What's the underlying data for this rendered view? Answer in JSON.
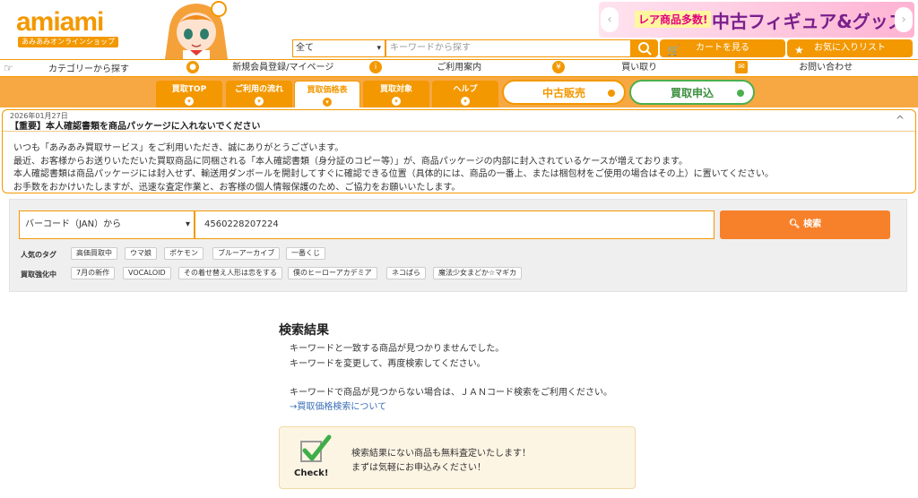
{
  "header": {
    "logo_text": "amiami",
    "logo_sub": "あみあみオンラインショップ",
    "banner_tag": "レア商品多数!",
    "banner_main": "中古フィギュア&グッズ",
    "category_select": "全て",
    "keyword_placeholder": "キーワードから探す",
    "cart_label": "カートを見る",
    "favorites_label": "お気に入りリスト"
  },
  "nav": {
    "category": "カテゴリーから探す",
    "register": "新規会員登録/マイページ",
    "guide": "ご利用案内",
    "buyback": "買い取り",
    "contact": "お問い合わせ"
  },
  "tabs": [
    {
      "label": "買取TOP"
    },
    {
      "label": "ご利用の流れ"
    },
    {
      "label": "買取価格表"
    },
    {
      "label": "買取対象"
    },
    {
      "label": "ヘルプ"
    }
  ],
  "pills": {
    "used_sales": "中古販売",
    "buyback_apply": "買取申込"
  },
  "notice": {
    "date": "2026年01月27日",
    "title": "【重要】本人確認書類を商品パッケージに入れないでください",
    "toggle": "^",
    "lines": [
      "いつも「あみあみ買取サービス」をご利用いただき、誠にありがとうございます。",
      "最近、お客様からお送りいただいた買取商品に同梱される「本人確認書類（身分証のコピー等）」が、商品パッケージの内部に封入されているケースが増えております。",
      "本人確認書類は商品パッケージには封入せず、輸送用ダンボールを開封してすぐに確認できる位置（具体的には、商品の一番上、または梱包材をご使用の場合はその上）に置いてください。",
      "お手数をおかけいたしますが、迅速な査定作業と、お客様の個人情報保護のため、ご協力をお願いいたします。"
    ]
  },
  "search": {
    "type_select": "バーコード（JAN）から",
    "input_value": "4560228207224",
    "button_label": "検索",
    "popular_label": "人気のタグ",
    "popular_tags": [
      "高価買取中",
      "ウマ娘",
      "ポケモン",
      "ブルーアーカイブ",
      "一番くじ"
    ],
    "boost_label": "買取強化中",
    "boost_tags": [
      "7月の新作",
      "VOCALOID",
      "その着せ替え人形は恋をする",
      "僕のヒーローアカデミア",
      "ネコぱら",
      "魔法少女まどか☆マギカ"
    ]
  },
  "results": {
    "title": "検索結果",
    "line1": "キーワードと一致する商品が見つかりませんでした。",
    "line2": "キーワードを変更して、再度検索してください。",
    "line3": "キーワードで商品が見つからない場合は、ＪＡＮコード検索をご利用ください。",
    "link": "→買取価格検索について",
    "check_label": "Check!",
    "check_line1": "検索結果にない商品も無料査定いたします！",
    "check_line2": "まずは気軽にお申込みください！"
  },
  "colors": {
    "accent": "#f39800",
    "tabbar": "#f7a842",
    "search_button": "#f7812a",
    "apply_green": "#4caf50",
    "link": "#3a6fb7"
  }
}
